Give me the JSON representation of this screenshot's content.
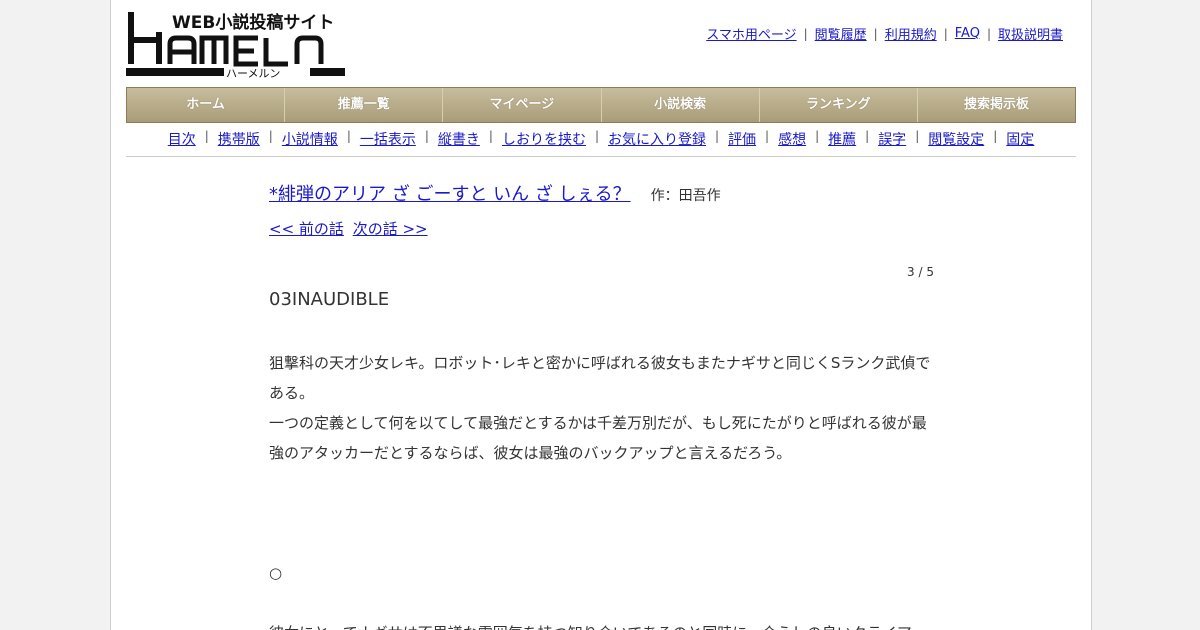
{
  "header": {
    "logo_tagline": "WEB小説投稿サイト",
    "logo_wordmark": "HAMELN",
    "logo_kana": "ハーメルン",
    "links": [
      "スマホ用ページ",
      "閲覧履歴",
      "利用規約",
      "FAQ",
      "取扱説明書"
    ]
  },
  "nav": [
    "ホーム",
    "推薦一覧",
    "マイページ",
    "小説検索",
    "ランキング",
    "捜索掲示板"
  ],
  "subnav": [
    "目次",
    "携帯版",
    "小説情報",
    "一括表示",
    "縦書き",
    "しおりを挟む",
    "お気に入り登録",
    "評価",
    "感想",
    "推薦",
    "誤字",
    "閲覧設定",
    "固定"
  ],
  "novel": {
    "title": "*緋弾のアリア ざ ごーすと いん ざ しぇる？",
    "author": "作：田吾作",
    "prev_link": "<< 前の話",
    "next_link": "次の話 >>",
    "page_count": "3 / 5",
    "chapter_title": "03INAUDIBLE",
    "paragraphs": [
      "狙撃科の天才少女レキ。ロボット･レキと密かに呼ばれる彼女もまたナギサと同じくSランク武偵である。",
      "一つの定義として何を以てして最強だとするかは千差万別だが、もし死にたがりと呼ばれる彼が最強のアタッカーだとするならば、彼女は最強のバックアップと言えるだろう。"
    ],
    "separator": "○",
    "continued_text": "彼女にとってナギサは不思議な雰囲気を持つ知り合いであるのと同時に、合うしの良いクライア"
  }
}
